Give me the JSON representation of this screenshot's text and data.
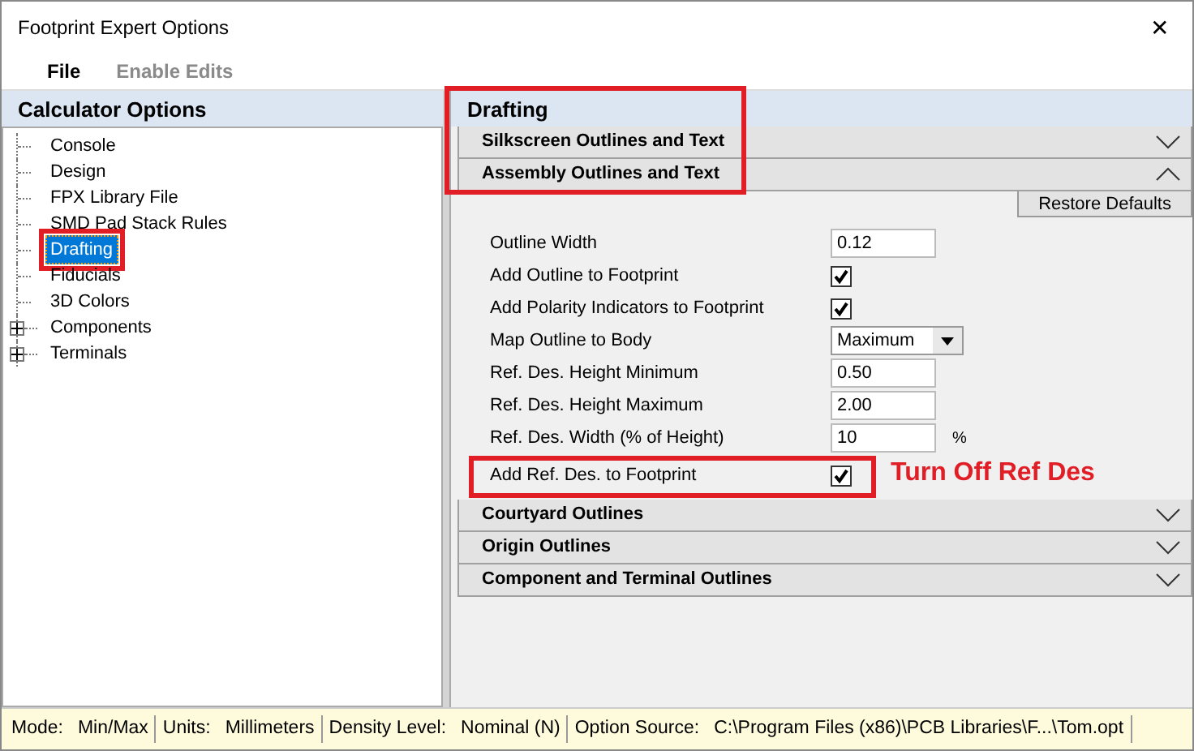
{
  "window": {
    "title": "Footprint Expert Options",
    "close": "✕"
  },
  "menu": [
    {
      "label": "File",
      "disabled": false
    },
    {
      "label": "Enable Edits",
      "disabled": true
    }
  ],
  "sidebar": {
    "title": "Calculator Options",
    "items": [
      {
        "label": "Console",
        "kind": "leaf",
        "selected": false,
        "highlighted": false
      },
      {
        "label": "Design",
        "kind": "leaf",
        "selected": false,
        "highlighted": false
      },
      {
        "label": "FPX Library File",
        "kind": "leaf",
        "selected": false,
        "highlighted": false
      },
      {
        "label": "SMD Pad Stack Rules",
        "kind": "leaf",
        "selected": false,
        "highlighted": false
      },
      {
        "label": "Drafting",
        "kind": "leaf",
        "selected": true,
        "highlighted": true
      },
      {
        "label": "Fiducials",
        "kind": "leaf",
        "selected": false,
        "highlighted": false
      },
      {
        "label": "3D Colors",
        "kind": "leaf",
        "selected": false,
        "highlighted": false
      },
      {
        "label": "Components",
        "kind": "folder",
        "expanded": false,
        "selected": false,
        "highlighted": false
      },
      {
        "label": "Terminals",
        "kind": "folder",
        "expanded": false,
        "selected": false,
        "highlighted": false
      }
    ]
  },
  "panel": {
    "title": "Drafting",
    "header_highlighted": true,
    "sections": [
      {
        "label": "Silkscreen Outlines and Text",
        "expanded": false
      },
      {
        "label": "Assembly Outlines and Text",
        "expanded": true,
        "restore_button": "Restore Defaults",
        "settings": [
          {
            "kind": "text",
            "label": "Outline Width",
            "value": "0.12",
            "highlighted": false
          },
          {
            "kind": "checkbox",
            "label": "Add Outline to Footprint",
            "checked": true,
            "highlighted": false
          },
          {
            "kind": "checkbox",
            "label": "Add Polarity Indicators to Footprint",
            "checked": true,
            "highlighted": false
          },
          {
            "kind": "select",
            "label": "Map Outline to Body",
            "value": "Maximum",
            "highlighted": false
          },
          {
            "kind": "text",
            "label": "Ref. Des. Height Minimum",
            "value": "0.50",
            "highlighted": false
          },
          {
            "kind": "text",
            "label": "Ref. Des. Height Maximum",
            "value": "2.00",
            "highlighted": false
          },
          {
            "kind": "text",
            "label": "Ref. Des. Width (% of Height)",
            "value": "10",
            "unit": "%",
            "highlighted": false
          },
          {
            "kind": "checkbox",
            "label": "Add Ref. Des. to Footprint",
            "checked": true,
            "highlighted": true,
            "annotation": "Turn Off Ref Des"
          }
        ]
      },
      {
        "label": "Courtyard Outlines",
        "expanded": false
      },
      {
        "label": "Origin Outlines",
        "expanded": false
      },
      {
        "label": "Component and Terminal Outlines",
        "expanded": false
      }
    ]
  },
  "status_bar": [
    {
      "label": "Mode:",
      "value": "Min/Max"
    },
    {
      "label": "Units:",
      "value": "Millimeters"
    },
    {
      "label": "Density Level:",
      "value": "Nominal (N)"
    },
    {
      "label": "Option Source:",
      "value": "C:\\Program Files (x86)\\PCB Libraries\\F...\\Tom.opt"
    }
  ]
}
